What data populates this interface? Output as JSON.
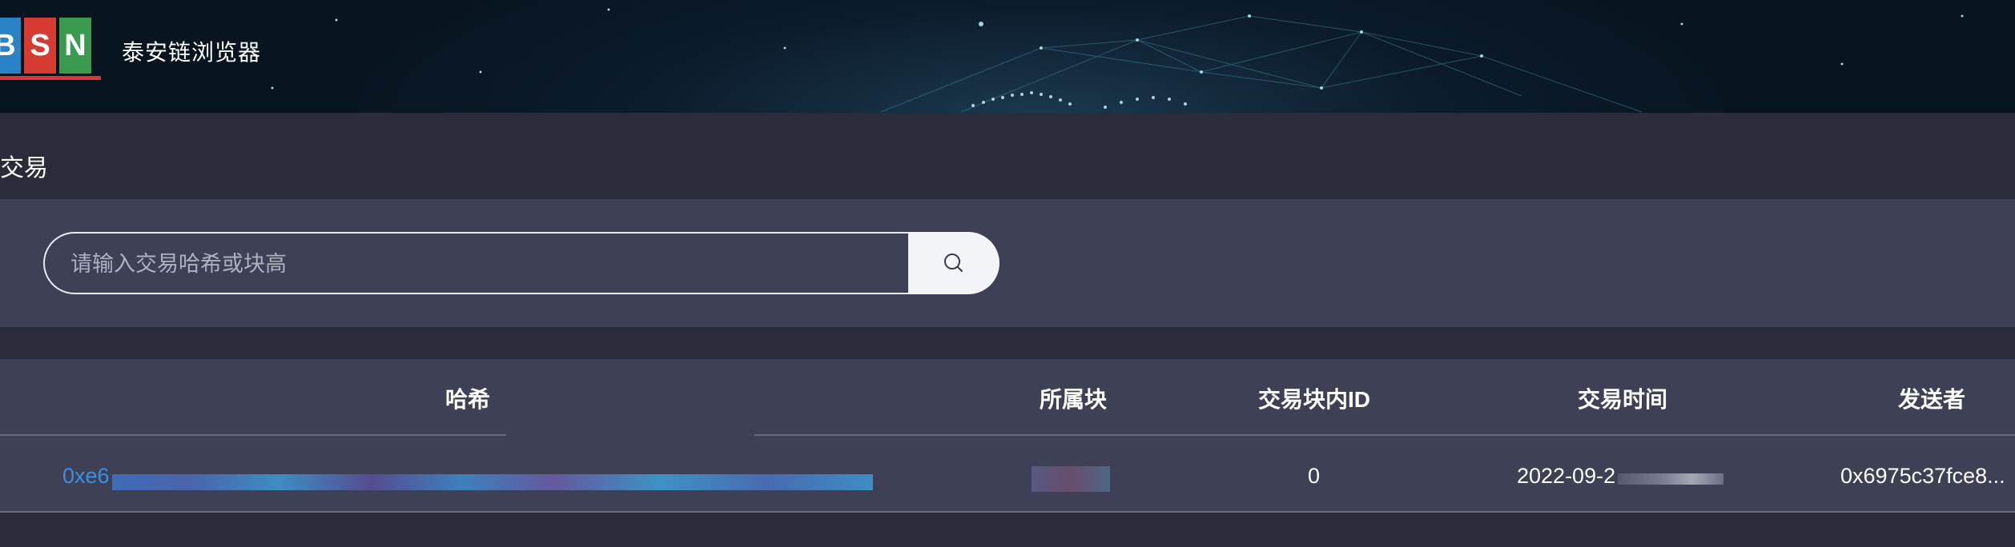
{
  "header": {
    "logo_letters": [
      "B",
      "S",
      "N"
    ],
    "logo_colors": [
      "#2a83c4",
      "#d63b32",
      "#3a9a4e"
    ],
    "brand_name": "泰安链浏览器"
  },
  "page": {
    "title": "交易"
  },
  "search": {
    "placeholder": "请输入交易哈希或块高",
    "value": "",
    "icon": "search-icon"
  },
  "table": {
    "columns": [
      "哈希",
      "所属块",
      "交易块内ID",
      "交易时间",
      "发送者"
    ],
    "rows": [
      {
        "hash": "0xe6",
        "block": "",
        "tx_index": "0",
        "time": "2022-09-2",
        "sender": "0x6975c37fce8..."
      }
    ]
  },
  "colors": {
    "accent": "#3b8fe4",
    "panel": "#3e4055",
    "background": "#2b2c3b"
  }
}
